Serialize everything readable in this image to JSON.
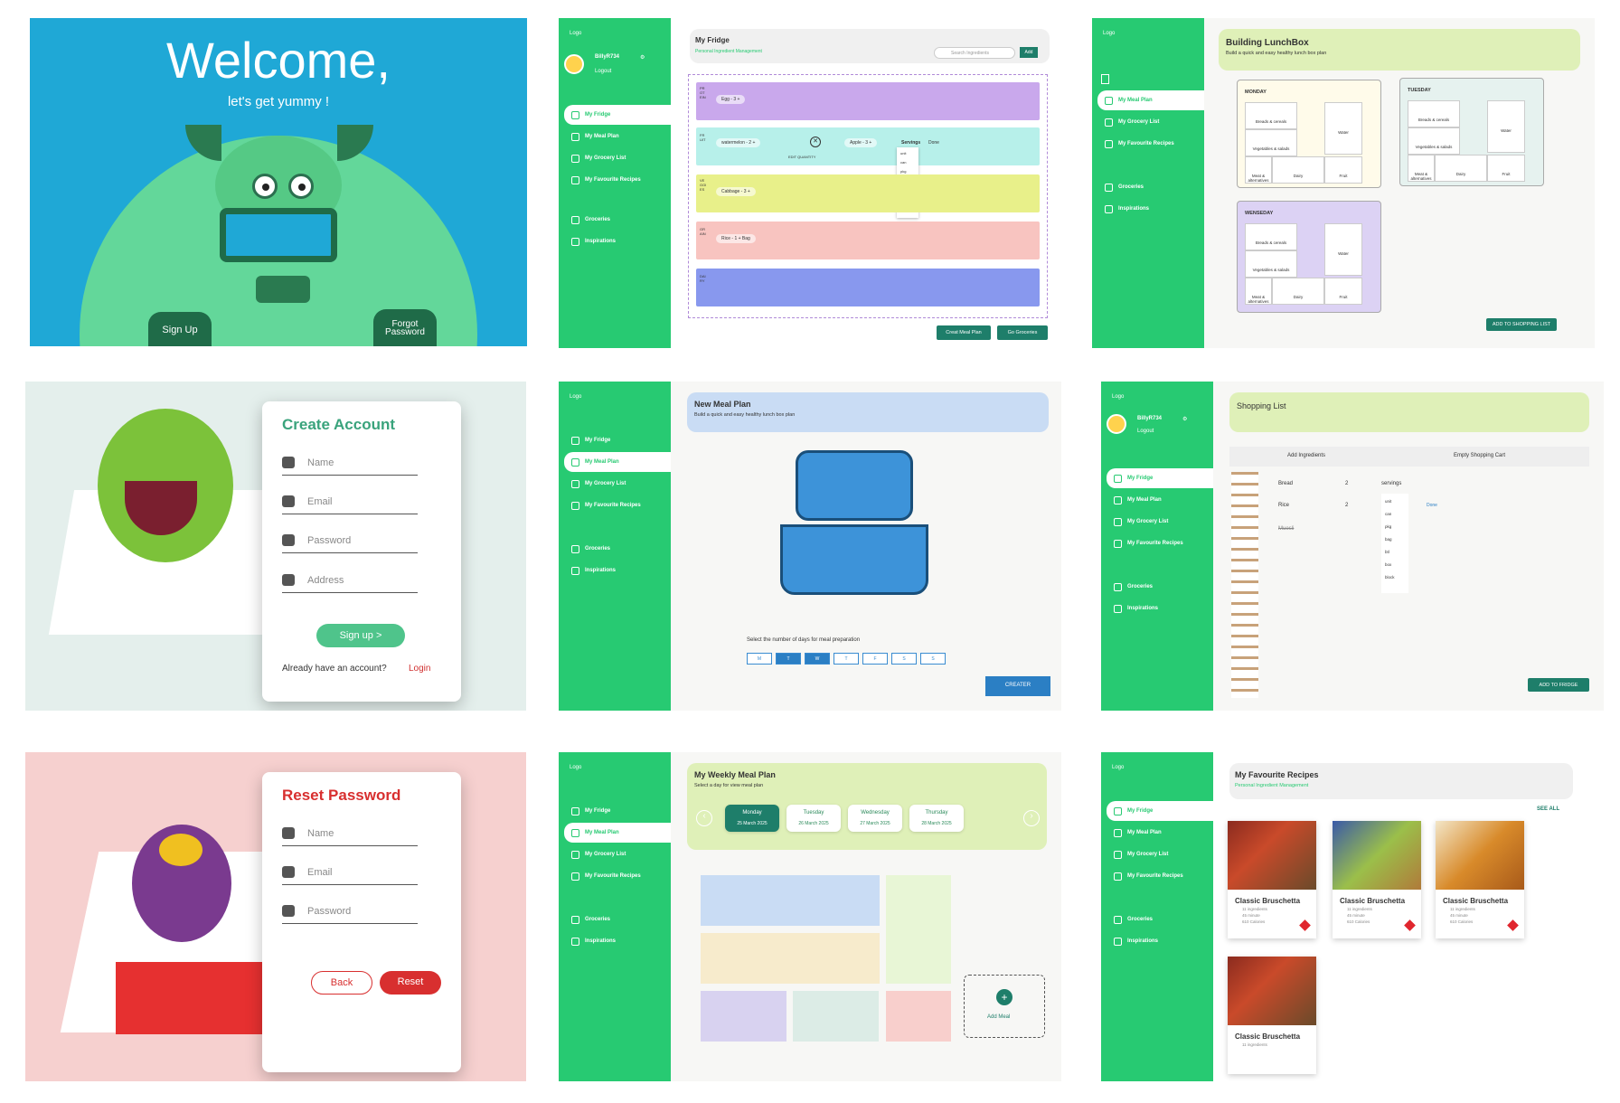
{
  "welcome": {
    "title": "Welcome,",
    "subtitle": "let's get yummy !",
    "signup": "Sign Up",
    "forgot": "Forgot Password"
  },
  "sidebar": {
    "logo": "Logo",
    "user": "BillyR734",
    "logout": "Logout",
    "items": [
      "My Fridge",
      "My Meal Plan",
      "My Grocery List",
      "My Favourite Recipes",
      "Groceries",
      "Inspirations"
    ]
  },
  "fridge": {
    "title": "My Fridge",
    "subtitle": "Personal Ingredient Management",
    "search": "Search Ingredients",
    "add": "Add",
    "rows": [
      {
        "label": "PROTEIN",
        "pill": "Egg  - 3 +"
      },
      {
        "label": "FRUIT",
        "pill": "watermelon  - 2 +",
        "pill2": "Apple  - 3 +",
        "servings": "Servings",
        "done": "Done",
        "edit": "EDIT QUANTITY"
      },
      {
        "label": "VEGGIES",
        "pill": "Cabbage  - 3 +"
      },
      {
        "label": "GRAIN",
        "pill": "Rice  - 1 +  Bag"
      },
      {
        "label": "DAIRY",
        "pill": ""
      }
    ],
    "units": [
      "unit",
      "can",
      "pkg",
      "bag",
      "btl",
      "box",
      "block"
    ],
    "btn1": "Creat Meal Plan",
    "btn2": "Go Groceries"
  },
  "lunchbox": {
    "title": "Building LunchBox",
    "subtitle": "Build a quick and easy healthy lunch box plan",
    "days": [
      "MONDAY",
      "TUESDAY",
      "WENSEDAY"
    ],
    "cells": [
      "Breads & cereals",
      "Vegetables & salads",
      "Meat & alternatives",
      "Dairy",
      "Water",
      "Fruit"
    ],
    "btn": "ADD TO SHOPPING LIST"
  },
  "create": {
    "title": "Create Account",
    "fields": [
      "Name",
      "Email",
      "Password",
      "Address"
    ],
    "btn": "Sign up  >",
    "already": "Already have an account?",
    "login": "Login"
  },
  "newplan": {
    "title": "New  Meal Plan",
    "subtitle": "Build a quick and easy healthy lunch box plan",
    "select": "Select the number of days for meal preparation",
    "days": [
      "M",
      "T",
      "W",
      "T",
      "F",
      "S",
      "S"
    ],
    "creater": "CREATER"
  },
  "shopping": {
    "title": "Shopping List",
    "addIng": "Add Ingredients",
    "empty": "Empty Shopping Cart",
    "items": [
      "Bread",
      "Rice",
      "Muesli"
    ],
    "qty": "2",
    "servings": "servings",
    "done": "Done",
    "units": [
      "unit",
      "can",
      "pkg",
      "bag",
      "btl",
      "box",
      "block"
    ],
    "btn": "ADD TO FRIDGE"
  },
  "reset": {
    "title": "Reset Password",
    "fields": [
      "Name",
      "Email",
      "Password"
    ],
    "back": "Back",
    "reset": "Reset"
  },
  "weekly": {
    "title": "My Weekly Meal Plan",
    "subtitle": "Select a day for view meal plan",
    "days": [
      {
        "d": "Monday",
        "dt": "25 March 2025"
      },
      {
        "d": "Tuesday",
        "dt": "26 March 2025"
      },
      {
        "d": "Wednesday",
        "dt": "27 March 2025"
      },
      {
        "d": "Thursday",
        "dt": "28 March 2025"
      }
    ],
    "addMeal": "Add Meal"
  },
  "fav": {
    "title": "My Favourite Recipes",
    "subtitle": "Personal Ingredient Management",
    "seeAll": "SEE ALL",
    "recipe": "Classic Bruschetta",
    "ing": "11 ingredients",
    "min": "45 minute",
    "cal": "610 Calories"
  }
}
